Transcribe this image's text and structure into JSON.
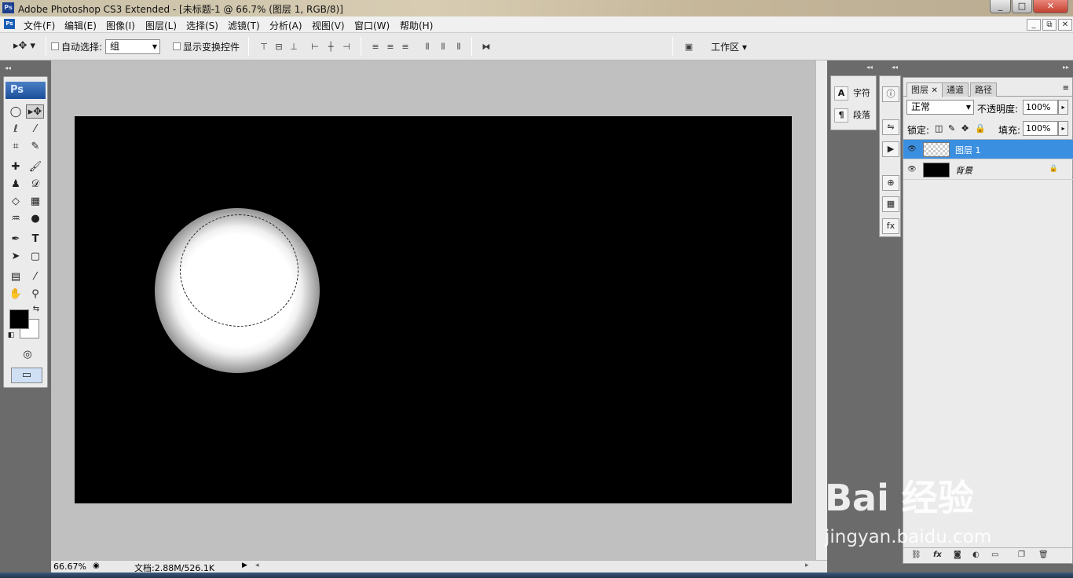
{
  "window": {
    "title": "Adobe Photoshop CS3 Extended - [未标题-1 @ 66.7% (图层 1, RGB/8)]",
    "logo": "Ps",
    "controls": [
      "_",
      "□",
      "✕"
    ]
  },
  "menu": {
    "logo": "Ps",
    "items": [
      "文件(F)",
      "编辑(E)",
      "图像(I)",
      "图层(L)",
      "选择(S)",
      "滤镜(T)",
      "分析(A)",
      "视图(V)",
      "窗口(W)",
      "帮助(H)"
    ],
    "doc_controls": [
      "_",
      "⧉",
      "✕"
    ]
  },
  "options": {
    "auto_select_label": "自动选择:",
    "auto_select_value": "组",
    "show_transform_label": "显示变换控件",
    "workspace_label": "工作区"
  },
  "tools": {
    "logo": "Ps"
  },
  "status": {
    "zoom": "66.67%",
    "doc_size": "文档:2.88M/526.1K"
  },
  "char_panel": {
    "character_label": "字符",
    "paragraph_label": "段落"
  },
  "layers_panel": {
    "tabs": [
      "图层",
      "通道",
      "路径"
    ],
    "blend_mode": "正常",
    "opacity_label": "不透明度:",
    "opacity_value": "100%",
    "lock_label": "锁定:",
    "fill_label": "填充:",
    "fill_value": "100%",
    "layers": [
      {
        "name": "图层 1",
        "selected": true
      },
      {
        "name": "背景",
        "selected": false
      }
    ]
  },
  "watermark": {
    "brand": "Bai 经验",
    "url": "jingyan.baidu.com"
  },
  "colors": {
    "foreground": "#000000",
    "background": "#ffffff",
    "selection_highlight": "#3b8fe0"
  }
}
